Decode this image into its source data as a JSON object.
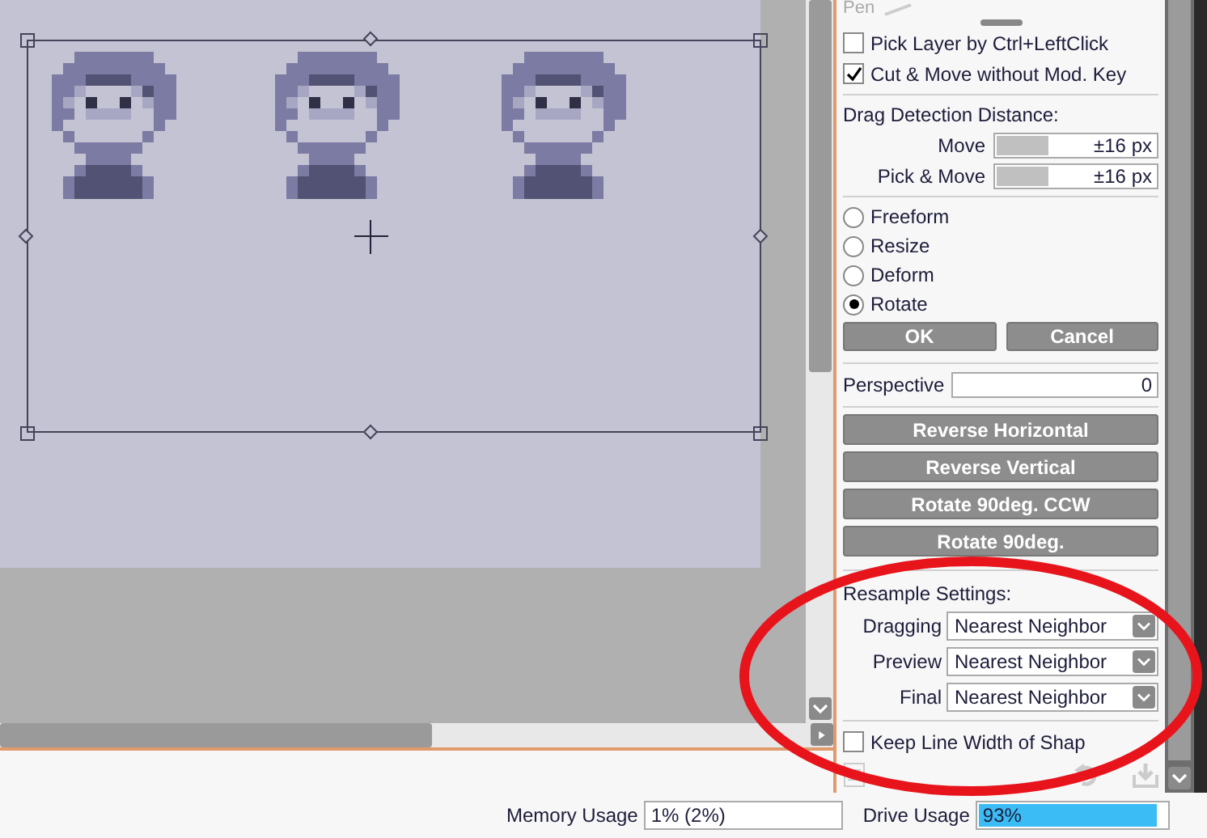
{
  "toolbar": {
    "tool_label": "Pen"
  },
  "options": [
    {
      "label": "Pick Layer by Ctrl+LeftClick",
      "checked": false
    },
    {
      "label": "Cut & Move without Mod. Key",
      "checked": true
    }
  ],
  "drag_detection": {
    "title": "Drag Detection Distance:",
    "rows": [
      {
        "label": "Move",
        "value": "±16 px",
        "level": 0.32
      },
      {
        "label": "Pick & Move",
        "value": "±16 px",
        "level": 0.32
      }
    ]
  },
  "modes": [
    {
      "label": "Freeform",
      "selected": false
    },
    {
      "label": "Resize",
      "selected": false
    },
    {
      "label": "Deform",
      "selected": false
    },
    {
      "label": "Rotate",
      "selected": true
    }
  ],
  "confirm_buttons": [
    "OK",
    "Cancel"
  ],
  "perspective": {
    "label": "Perspective",
    "value": "0"
  },
  "actions": [
    "Reverse Horizontal",
    "Reverse Vertical",
    "Rotate 90deg. CCW",
    "Rotate 90deg."
  ],
  "resample": {
    "title": "Resample Settings:",
    "rows": [
      {
        "label": "Dragging",
        "value": "Nearest Neighbor"
      },
      {
        "label": "Preview",
        "value": "Nearest Neighbor"
      },
      {
        "label": "Final",
        "value": "Nearest Neighbor"
      }
    ]
  },
  "keep_line_width": {
    "label": "Keep Line Width of Shap",
    "checked": false
  },
  "status_bar": {
    "memory_label": "Memory Usage",
    "memory_value": "1% (2%)",
    "drive": {
      "label": "Drive Usage",
      "value": "93%",
      "level": 0.93
    }
  }
}
